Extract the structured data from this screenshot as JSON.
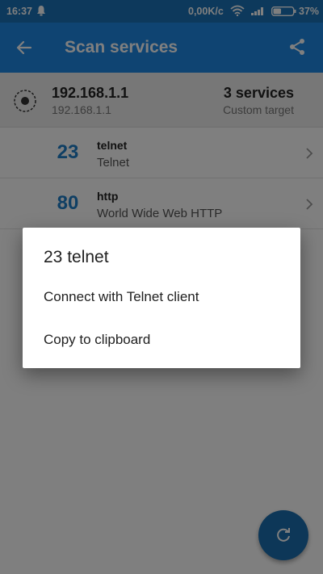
{
  "status_bar": {
    "time": "16:37",
    "notification_icon": "notification-icon",
    "speed": "0,00K/c",
    "battery": "37%"
  },
  "app_bar": {
    "title": "Scan services",
    "back_icon": "back-arrow-icon",
    "share_icon": "share-icon"
  },
  "target": {
    "ip": "192.168.1.1",
    "subtitle": "192.168.1.1",
    "services_count": "3 services",
    "target_type": "Custom target"
  },
  "services": [
    {
      "port": "23",
      "name": "telnet",
      "description": "Telnet"
    },
    {
      "port": "80",
      "name": "http",
      "description": "World Wide Web HTTP"
    }
  ],
  "dialog": {
    "title": "23 telnet",
    "items": [
      {
        "label": "Connect with Telnet client"
      },
      {
        "label": "Copy to clipboard"
      }
    ]
  },
  "fab": {
    "icon": "refresh-icon"
  },
  "colors": {
    "status_bar": "#1b73b8",
    "app_bar": "#1e88e5",
    "port_accent": "#1e7ec8",
    "fab": "#1b6fb0"
  }
}
